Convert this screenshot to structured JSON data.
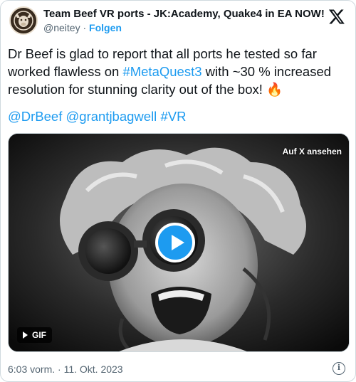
{
  "author": {
    "name": "Team Beef VR ports - JK:Academy, Quake4 in EA NOW!",
    "handle": "@neitey",
    "separator": " · ",
    "follow_label": "Folgen",
    "avatar_icon": "team-beef-logo"
  },
  "tweet": {
    "text_part1": "Dr Beef is glad to report that all ports he tested so far worked flawless on ",
    "hashtag_quest": "#MetaQuest3",
    "text_part2": " with ~30 % increased resolution for stunning clarity out of the box! ",
    "emoji": "🔥",
    "mentions": [
      "@DrBeef",
      "@grantjbagwell",
      "#VR"
    ]
  },
  "media": {
    "view_on_x_label": "Auf X ansehen",
    "badge_label": "GIF",
    "play_icon": "play-icon"
  },
  "footer": {
    "timestamp": "6:03 vorm. · 11. Okt. 2023",
    "info_icon": "info-icon"
  },
  "colors": {
    "accent": "#1d9bf0",
    "text": "#0f1419",
    "muted": "#536471",
    "border": "#cfd9de"
  }
}
